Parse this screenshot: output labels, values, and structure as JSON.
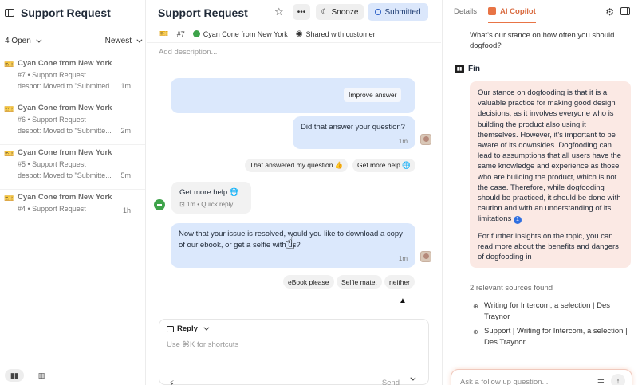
{
  "left": {
    "title": "Support Request",
    "filter_open": "4 Open",
    "filter_sort": "Newest",
    "conversations": [
      {
        "name": "Cyan Cone from New York",
        "sub": "#7 • Support Request",
        "preview": "desbot: Moved to \"Submitted...",
        "time": "1m"
      },
      {
        "name": "Cyan Cone from New York",
        "sub": "#6 • Support Request",
        "preview": "desbot: Moved to \"Submitte...",
        "time": "2m"
      },
      {
        "name": "Cyan Cone from New York",
        "sub": "#5 • Support Request",
        "preview": "desbot: Moved to \"Submitte...",
        "time": "5m"
      },
      {
        "name": "Cyan Cone from New York",
        "sub": "#4 • Support Request",
        "preview": "",
        "time": "1h"
      }
    ]
  },
  "middle": {
    "title": "Support Request",
    "snooze": "Snooze",
    "submitted": "Submitted",
    "ticket_id": "#7",
    "customer": "Cyan Cone from New York",
    "shared": "Shared with customer",
    "description_placeholder": "Add description...",
    "messages": {
      "improve": "Improve answer",
      "did_answer": "Did that answer your question?",
      "did_answer_time": "1m",
      "reply_a": "That answered my question 👍",
      "reply_b": "Get more help 🌐",
      "get_more_help": "Get more help 🌐",
      "get_more_help_meta": "1m • Quick reply",
      "resolved": "Now that your issue is resolved, would you like to download a copy of our ebook, or get a selfie with us?",
      "resolved_time": "1m",
      "opt1": "eBook please",
      "opt2": "Selfie mate.",
      "opt3": "neither"
    },
    "reply": {
      "type": "Reply",
      "placeholder": "Use ⌘K for shortcuts",
      "send": "Send"
    }
  },
  "right": {
    "tab_details": "Details",
    "tab_copilot": "AI Copilot",
    "question": "What's our stance on how often you should dogfood?",
    "fin": "Fin",
    "answer_p1": "Our stance on dogfooding is that it is a valuable practice for making good design decisions, as it involves everyone who is building the product also using it themselves. However, it's important to be aware of its downsides. Dogfooding can lead to assumptions that all users have the same knowledge and experience as those who are building the product, which is not the case. Therefore, while dogfooding should be practiced, it should be done with caution and with an understanding of its limitations",
    "cite": "1",
    "answer_p2": "For further insights on the topic, you can read more about the benefits and dangers of dogfooding in",
    "sources_title": "2 relevant sources found",
    "sources": [
      "Writing for Intercom, a selection | Des Traynor",
      "Support | Writing for Intercom, a selection | Des Traynor"
    ],
    "ask_placeholder": "Ask a follow up question..."
  },
  "colors": {
    "accent": "#e87445",
    "bubble": "#dbe8fc",
    "answer_bg": "#fbe9e4",
    "submitted_bg": "#dbe7fb"
  }
}
